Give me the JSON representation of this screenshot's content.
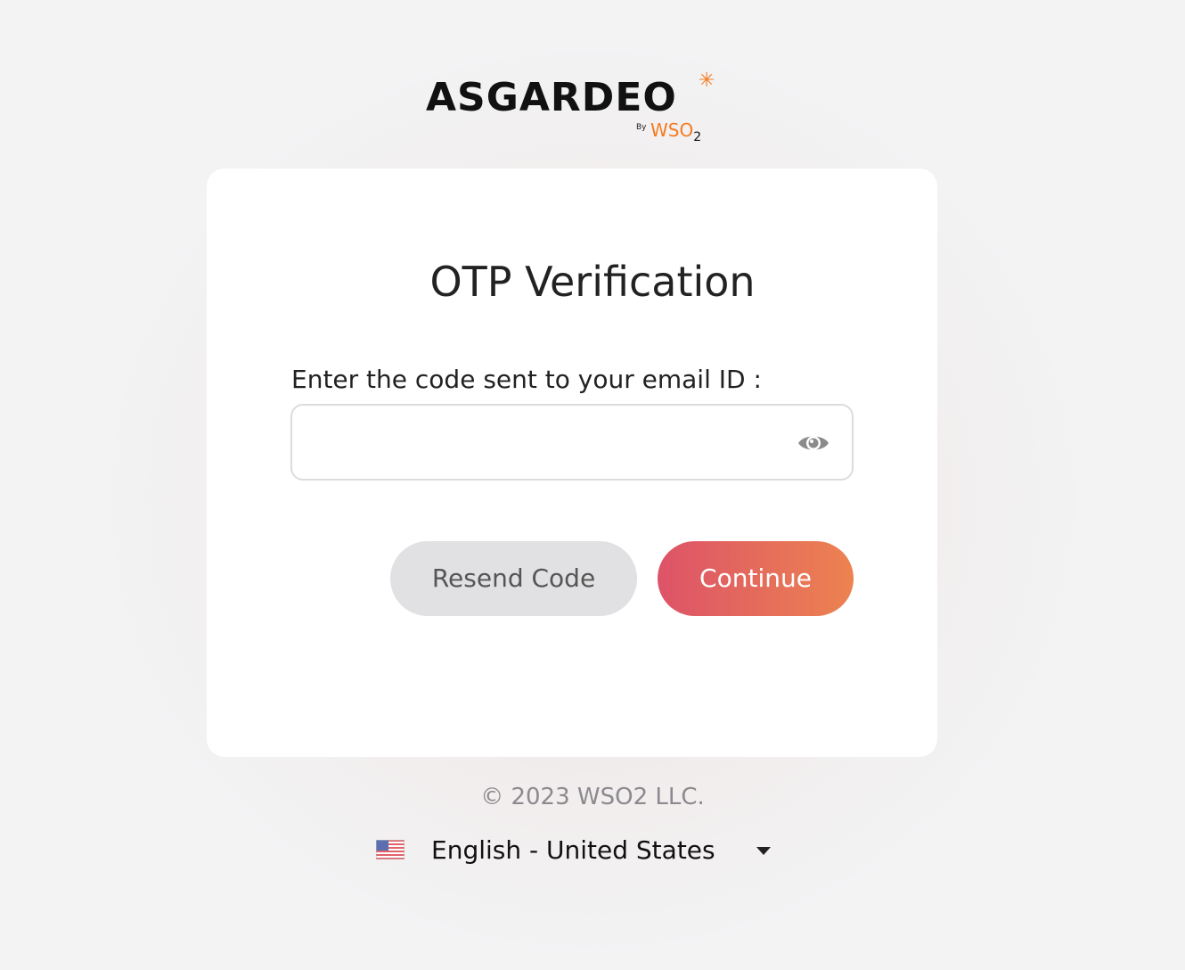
{
  "brand": {
    "name": "ASGARDEO",
    "by": "By",
    "company": "WSO",
    "company_sub": "2",
    "accent": "#f47b20"
  },
  "form": {
    "title": "OTP Verification",
    "label": "Enter the code sent to your email ID :",
    "otp_value": "",
    "toggle_icon": "eye-icon"
  },
  "buttons": {
    "resend": "Resend Code",
    "continue": "Continue",
    "continue_gradient": [
      "#dd5368",
      "#ec8350"
    ]
  },
  "footer": {
    "copyright": "© 2023 WSO2 LLC.",
    "language": "English - United States",
    "language_flag": "us-flag-icon"
  }
}
